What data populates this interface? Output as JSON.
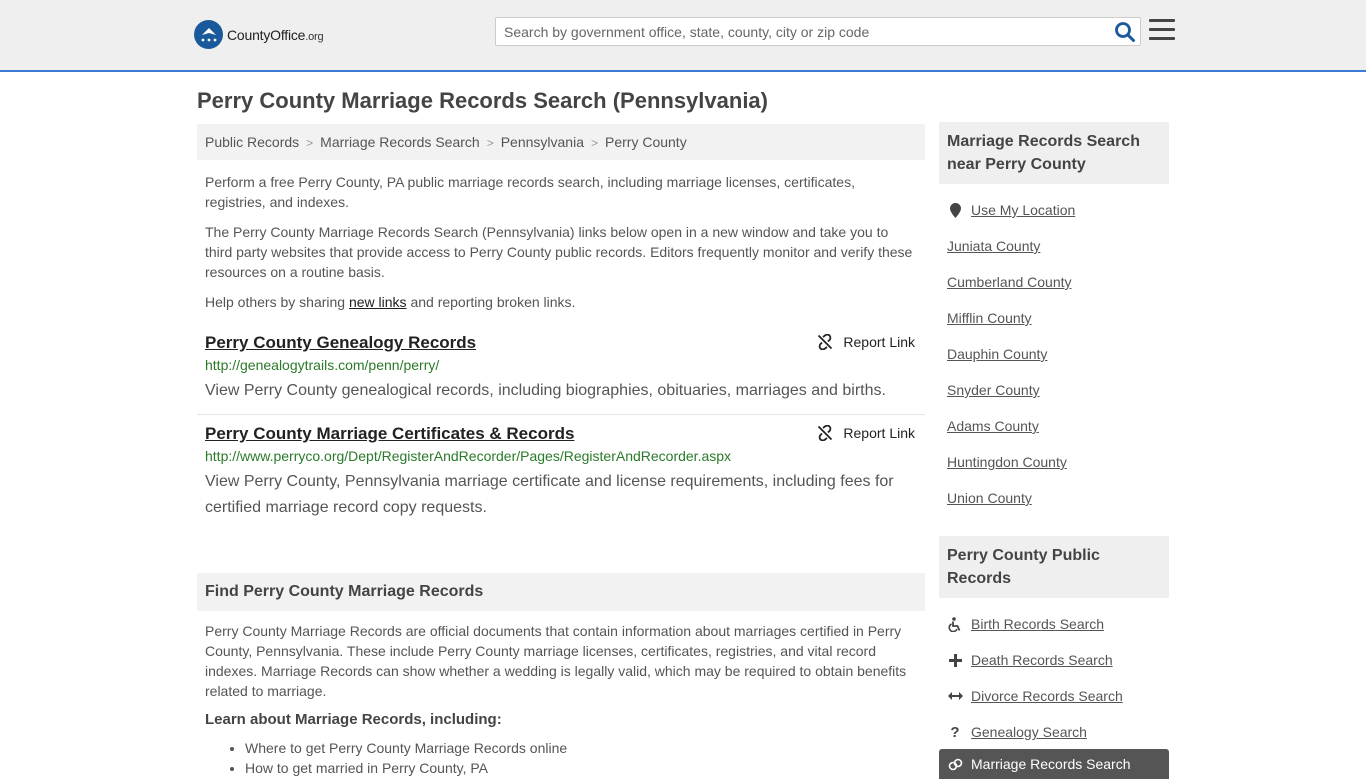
{
  "header": {
    "logo_text_main": "CountyOffice",
    "logo_text_org": ".org",
    "search_placeholder": "Search by government office, state, county, city or zip code"
  },
  "page_title": "Perry County Marriage Records Search (Pennsylvania)",
  "breadcrumb": [
    "Public Records",
    "Marriage Records Search",
    "Pennsylvania",
    "Perry County"
  ],
  "intro": {
    "p1": "Perform a free Perry County, PA public marriage records search, including marriage licenses, certificates, registries, and indexes.",
    "p2": "The Perry County Marriage Records Search (Pennsylvania) links below open in a new window and take you to third party websites that provide access to Perry County public records. Editors frequently monitor and verify these resources on a routine basis.",
    "p3_before": "Help others by sharing ",
    "p3_link": "new links",
    "p3_after": " and reporting broken links."
  },
  "results": [
    {
      "title": "Perry County Genealogy Records",
      "url": "http://genealogytrails.com/penn/perry/",
      "desc": "View Perry County genealogical records, including biographies, obituaries, marriages and births.",
      "report_label": "Report Link"
    },
    {
      "title": "Perry County Marriage Certificates & Records",
      "url": "http://www.perryco.org/Dept/RegisterAndRecorder/Pages/RegisterAndRecorder.aspx",
      "desc": "View Perry County, Pennsylvania marriage certificate and license requirements, including fees for certified marriage record copy requests.",
      "report_label": "Report Link"
    }
  ],
  "find_section": {
    "heading": "Find Perry County Marriage Records",
    "body": "Perry County Marriage Records are official documents that contain information about marriages certified in Perry County, Pennsylvania. These include Perry County marriage licenses, certificates, registries, and vital record indexes. Marriage Records can show whether a wedding is legally valid, which may be required to obtain benefits related to marriage.",
    "learn_heading": "Learn about Marriage Records, including:",
    "learn_items": [
      "Where to get Perry County Marriage Records online",
      "How to get married in Perry County, PA"
    ]
  },
  "sidebar_nearby": {
    "heading": "Marriage Records Search near Perry County",
    "use_location": "Use My Location",
    "counties": [
      "Juniata County",
      "Cumberland County",
      "Mifflin County",
      "Dauphin County",
      "Snyder County",
      "Adams County",
      "Huntingdon County",
      "Union County"
    ]
  },
  "sidebar_public": {
    "heading": "Perry County Public Records",
    "items": [
      {
        "label": "Birth Records Search",
        "icon": "wheelchair-icon"
      },
      {
        "label": "Death Records Search",
        "icon": "plus-icon"
      },
      {
        "label": "Divorce Records Search",
        "icon": "arrows-horizontal-icon"
      },
      {
        "label": "Genealogy Search",
        "icon": "question-icon"
      }
    ],
    "active_item": "Marriage Records Search"
  }
}
